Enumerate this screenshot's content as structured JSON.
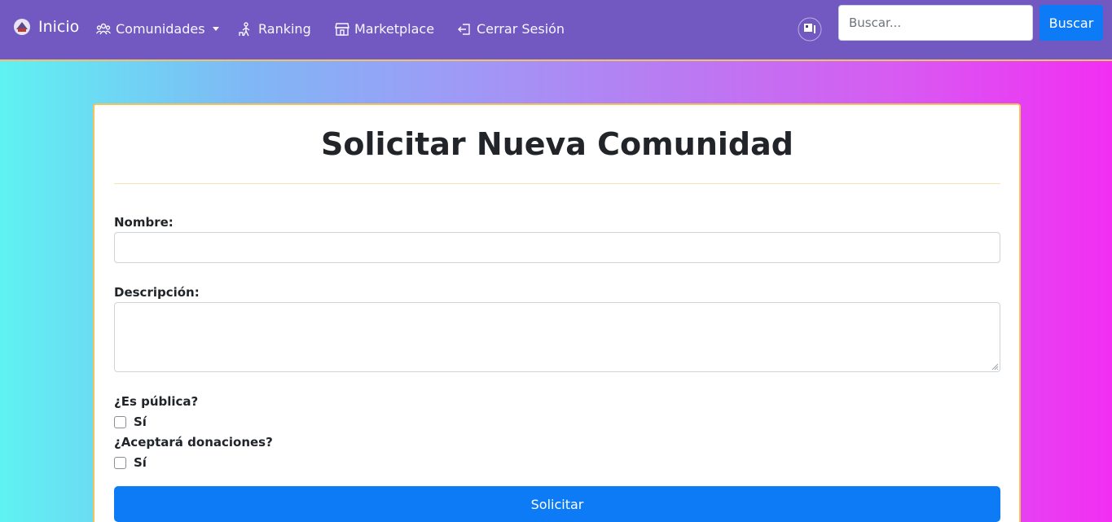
{
  "navbar": {
    "brand_label": "Inicio",
    "items": [
      {
        "label": "Comunidades",
        "icon": "people-icon"
      },
      {
        "label": "Ranking",
        "icon": "ranking-icon"
      },
      {
        "label": "Marketplace",
        "icon": "shop-icon"
      },
      {
        "label": "Cerrar Sesión",
        "icon": "logout-icon"
      }
    ],
    "search_placeholder": "Buscar...",
    "search_button": "Buscar"
  },
  "form": {
    "title": "Solicitar Nueva Comunidad",
    "nombre_label": "Nombre:",
    "nombre_value": "",
    "descripcion_label": "Descripción:",
    "descripcion_value": "",
    "publica_label": "¿Es pública?",
    "publica_option": "Sí",
    "publica_checked": false,
    "donaciones_label": "¿Aceptará donaciones?",
    "donaciones_option": "Sí",
    "donaciones_checked": false,
    "submit_label": "Solicitar"
  },
  "colors": {
    "navbar": "#7159c1",
    "primary": "#0d7bf5",
    "card_border": "#f5c35a"
  }
}
